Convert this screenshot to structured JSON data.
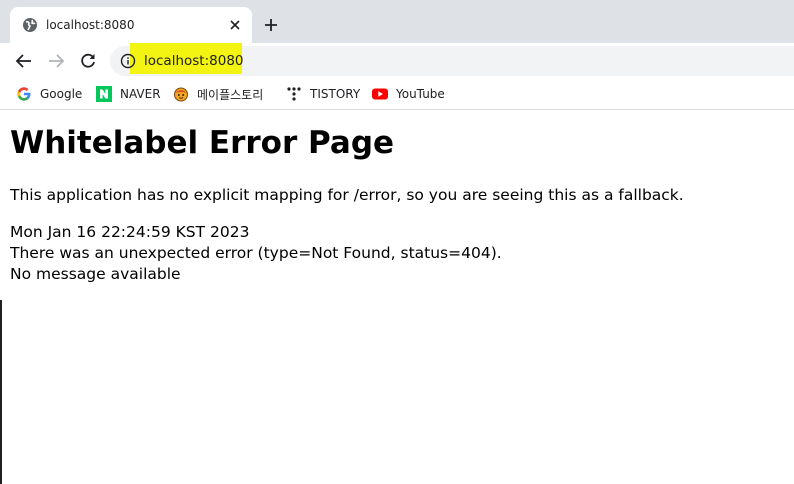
{
  "tab": {
    "title": "localhost:8080"
  },
  "toolbar": {
    "url": "localhost:8080"
  },
  "bookmarks": [
    {
      "label": "Google",
      "icon": "google-icon"
    },
    {
      "label": "NAVER",
      "icon": "naver-icon"
    },
    {
      "label": "메이플스토리",
      "icon": "maplestory-icon"
    },
    {
      "label": "TISTORY",
      "icon": "tistory-icon"
    },
    {
      "label": "YouTube",
      "icon": "youtube-icon"
    }
  ],
  "page": {
    "heading": "Whitelabel Error Page",
    "description": "This application has no explicit mapping for /error, so you are seeing this as a fallback.",
    "timestamp": "Mon Jan 16 22:24:59 KST 2023",
    "error": "There was an unexpected error (type=Not Found, status=404).",
    "message": "No message available"
  },
  "colors": {
    "tabstrip": "#dee1e6",
    "omnibox": "#f1f3f4",
    "highlight": "#f4f412",
    "naver_green": "#03c75a",
    "youtube_red": "#ff0000"
  }
}
